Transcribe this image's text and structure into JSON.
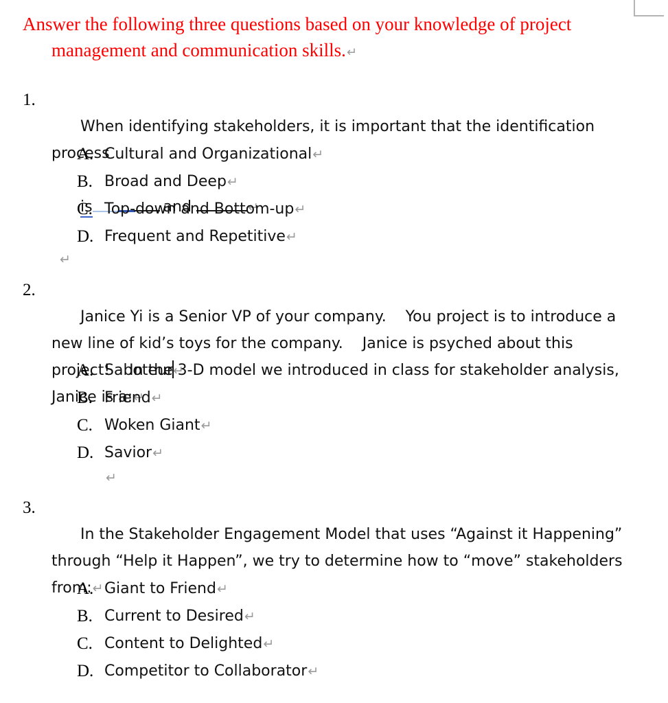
{
  "document": {
    "heading": {
      "line1": "Answer the following three questions based on your knowledge of project",
      "line2": "management and communication skills.",
      "color": "#fe0000"
    },
    "paragraph_mark": "↵",
    "questions": [
      {
        "number": "1.",
        "text": "When identifying stakeholders, it is important that the identification process",
        "blank_line": {
          "word_before": "is",
          "word_middle": "and"
        },
        "options": [
          {
            "letter": "A.",
            "text": "Cultural and Organizational"
          },
          {
            "letter": "B.",
            "text": "Broad and Deep"
          },
          {
            "letter": "C.",
            "text": "Top-down and Bottom-up"
          },
          {
            "letter": "D.",
            "text": "Frequent and Repetitive"
          }
        ]
      },
      {
        "number": "2.",
        "text": "Janice Yi is a Senior VP of your company.    You project is to introduce a new line of kid’s toys for the company.    Janice is psyched about this project!    In the 3-D model we introduced in class for stakeholder analysis, Janice is a:",
        "options": [
          {
            "letter": "A.",
            "text": "Saboteur",
            "has_caret": true
          },
          {
            "letter": "B.",
            "text": "Friend"
          },
          {
            "letter": "C.",
            "text": "Woken Giant"
          },
          {
            "letter": "D.",
            "text": "Savior"
          }
        ]
      },
      {
        "number": "3.",
        "text": "In the Stakeholder Engagement Model that uses “Against it Happening” through “Help it Happen”, we try to determine how to “move” stakeholders from:",
        "options": [
          {
            "letter": "A.",
            "text": "Giant to Friend"
          },
          {
            "letter": "B.",
            "text": "Current to Desired"
          },
          {
            "letter": "C.",
            "text": "Content to Delighted"
          },
          {
            "letter": "D.",
            "text": "Competitor to Collaborator"
          }
        ]
      }
    ]
  }
}
